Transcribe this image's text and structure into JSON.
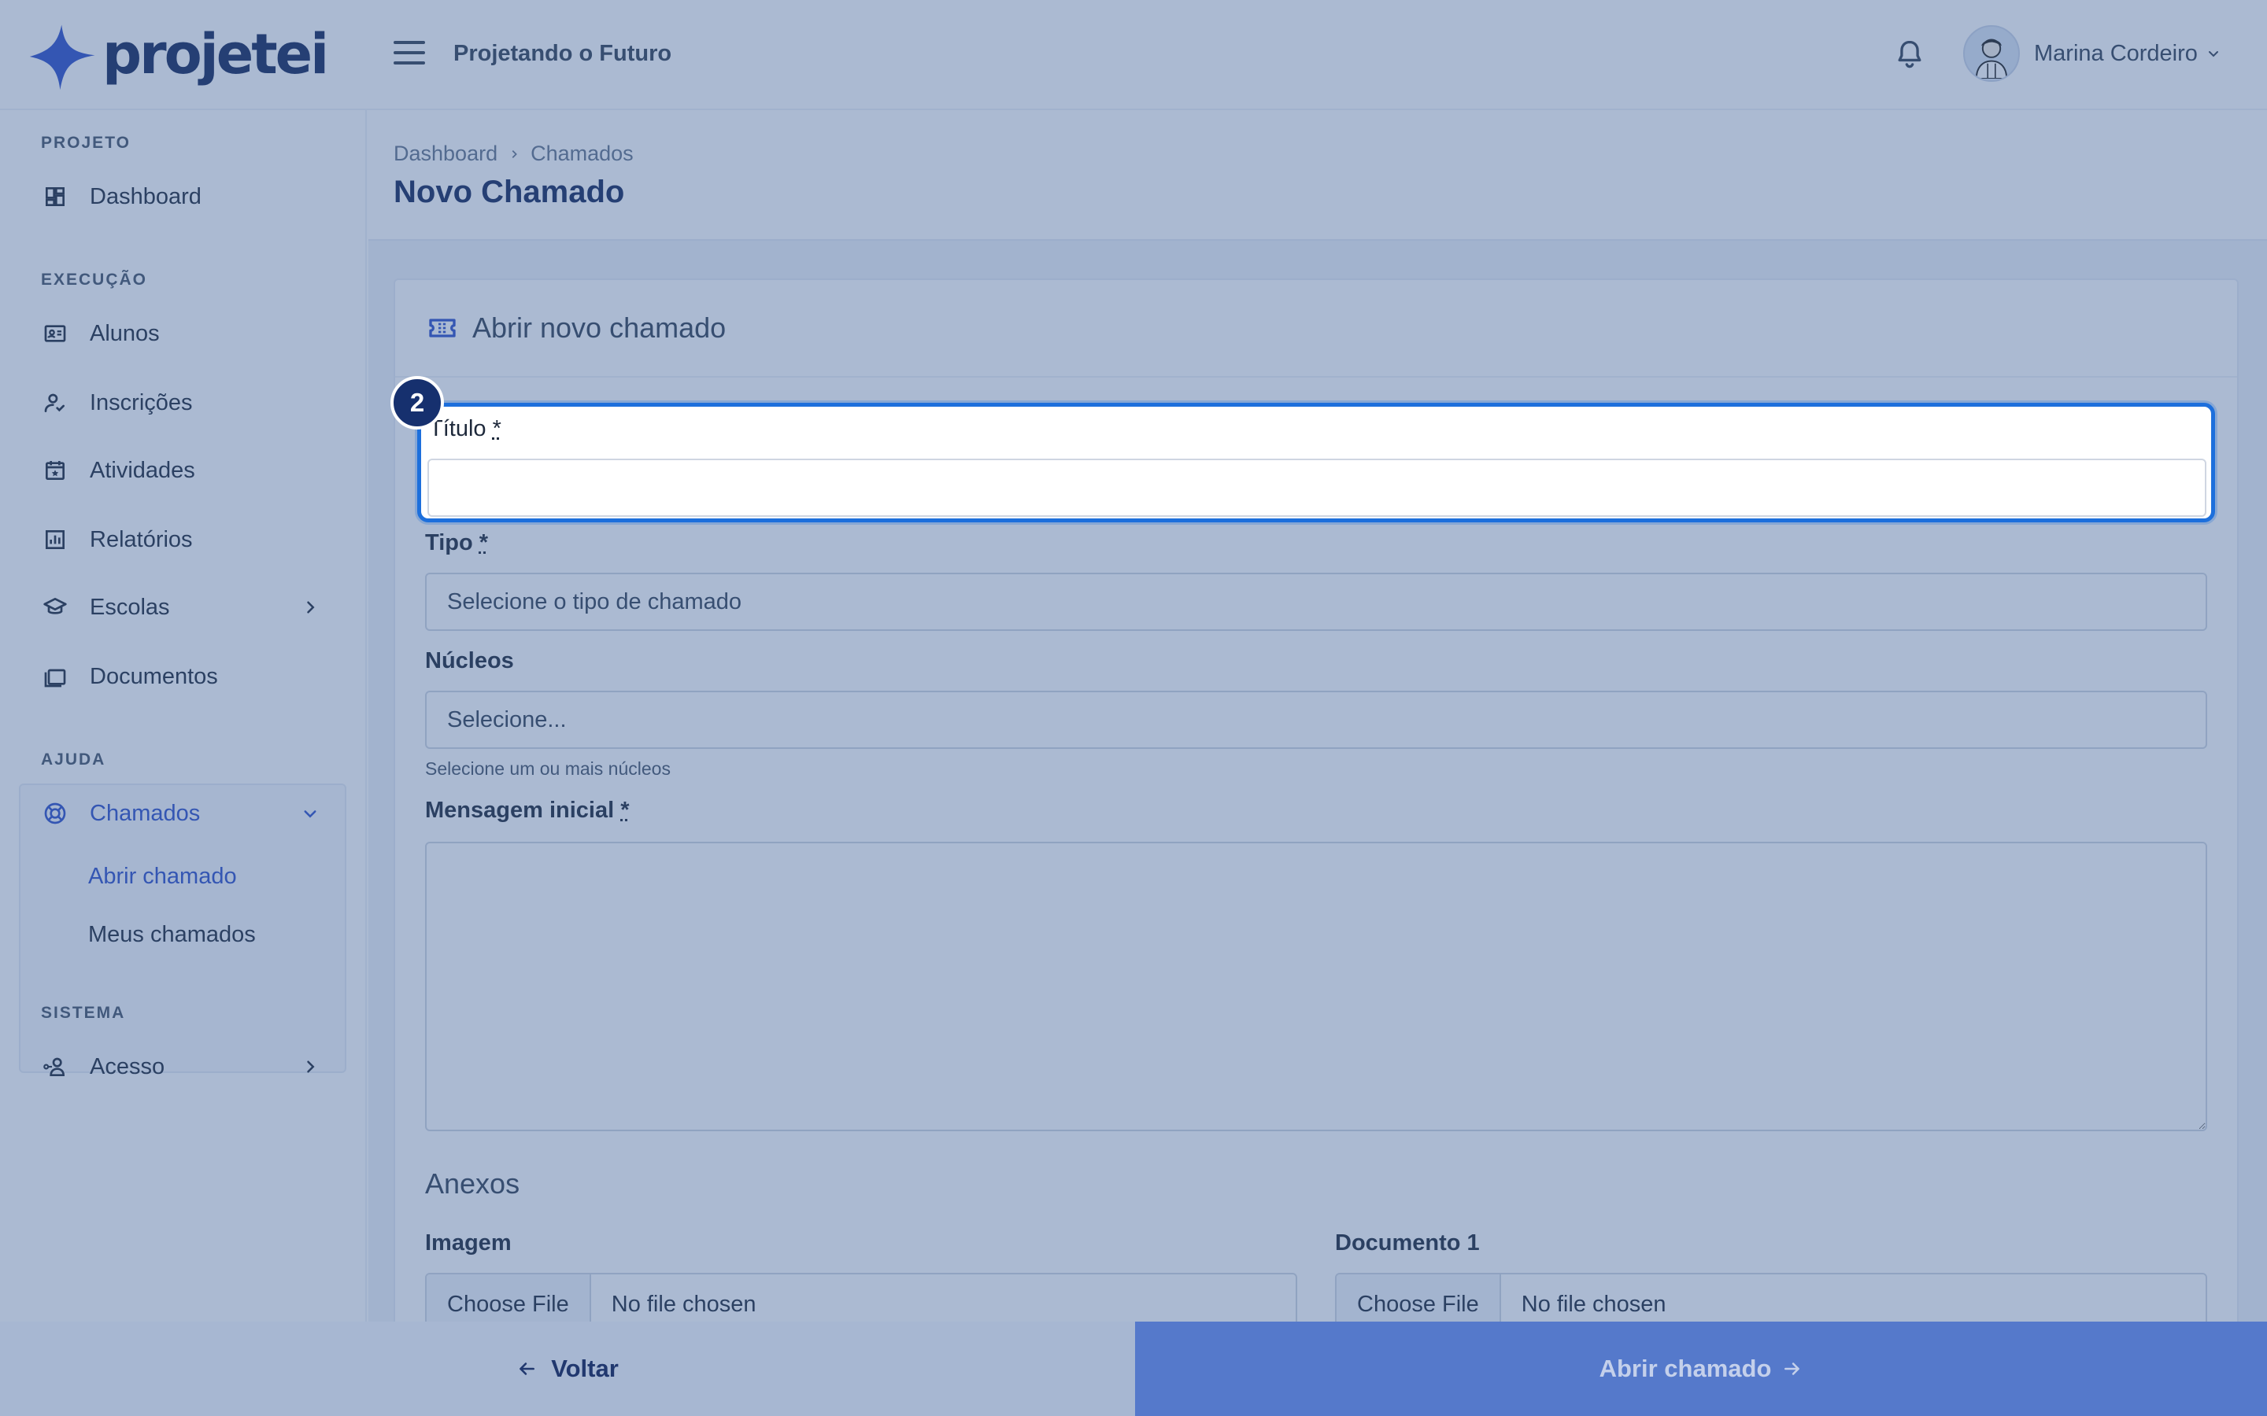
{
  "brand": {
    "name": "projetei",
    "color": "#2f50c8"
  },
  "header": {
    "project_name": "Projetando o Futuro",
    "user_name": "Marina Cordeiro",
    "icons": [
      "menu-icon",
      "bell-icon",
      "avatar",
      "chevron-down-icon"
    ]
  },
  "sidebar": {
    "sections": [
      {
        "title": "PROJETO",
        "items": [
          {
            "label": "Dashboard",
            "icon": "dashboard-icon"
          }
        ]
      },
      {
        "title": "EXECUÇÃO",
        "items": [
          {
            "label": "Alunos",
            "icon": "id-card-icon"
          },
          {
            "label": "Inscrições",
            "icon": "user-check-icon"
          },
          {
            "label": "Atividades",
            "icon": "calendar-star-icon"
          },
          {
            "label": "Relatórios",
            "icon": "bar-chart-icon"
          },
          {
            "label": "Escolas",
            "icon": "school-icon",
            "expandable": true
          }
        ]
      },
      {
        "title": "AJUDA",
        "items": [
          {
            "label": "Chamados",
            "icon": "lifebuoy-icon",
            "active": true,
            "expanded": true,
            "children": [
              {
                "label": "Abrir chamado",
                "active": true
              },
              {
                "label": "Meus chamados"
              }
            ]
          },
          {
            "label": "Documentos",
            "icon": "folders-icon"
          }
        ]
      },
      {
        "title": "SISTEMA",
        "items": [
          {
            "label": "Acesso",
            "icon": "user-key-icon",
            "expandable": true
          }
        ]
      }
    ]
  },
  "breadcrumb": {
    "items": [
      "Dashboard",
      "Chamados"
    ]
  },
  "page_title": "Novo Chamado",
  "form": {
    "card_title": "Abrir novo chamado",
    "fields": {
      "titulo": {
        "label": "Título",
        "required_mark": "*",
        "value": ""
      },
      "tipo": {
        "label": "Tipo",
        "required_mark": "*",
        "placeholder": "Selecione o tipo de chamado"
      },
      "nucleos": {
        "label": "Núcleos",
        "placeholder": "Selecione...",
        "help": "Selecione um ou mais núcleos"
      },
      "mensagem": {
        "label": "Mensagem inicial",
        "required_mark": "*",
        "value": ""
      }
    },
    "attachments": {
      "title": "Anexos",
      "imagem": {
        "label": "Imagem",
        "button": "Choose File",
        "status": "No file chosen"
      },
      "documento1": {
        "label": "Documento 1",
        "button": "Choose File",
        "status": "No file chosen"
      }
    }
  },
  "tutorial": {
    "step": "2",
    "highlight_color": "#1d6fdc"
  },
  "footer": {
    "back_label": "Voltar",
    "submit_label": "Abrir chamado"
  }
}
